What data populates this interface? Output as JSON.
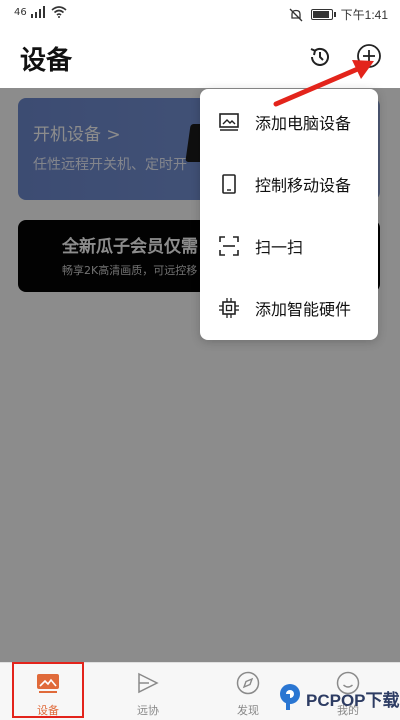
{
  "status_bar": {
    "carrier": "46",
    "time": "下午1:41",
    "battery_level": 0.8
  },
  "header": {
    "title": "设备"
  },
  "cards": {
    "power": {
      "title": "开机设备 >",
      "subtitle": "任性远程开关机、定时开"
    },
    "vip": {
      "title": "全新瓜子会员仅需",
      "subtitle": "畅享2K高清画质，可远控移"
    }
  },
  "popup_menu": {
    "items": [
      {
        "label": "添加电脑设备",
        "icon": "monitor-icon"
      },
      {
        "label": "控制移动设备",
        "icon": "phone-icon"
      },
      {
        "label": "扫一扫",
        "icon": "scan-icon"
      },
      {
        "label": "添加智能硬件",
        "icon": "chip-icon"
      }
    ]
  },
  "tabbar": {
    "tabs": [
      {
        "label": "设备",
        "icon": "device-icon",
        "active": true
      },
      {
        "label": "远协",
        "icon": "collab-icon",
        "active": false
      },
      {
        "label": "发现",
        "icon": "compass-icon",
        "active": false
      },
      {
        "label": "我的",
        "icon": "profile-icon",
        "active": false
      }
    ]
  },
  "watermark": {
    "text": "PCPOP下载"
  },
  "colors": {
    "accent": "#e06a3a",
    "annotation_red": "#e3241b",
    "card_blue": "#7895d8"
  }
}
